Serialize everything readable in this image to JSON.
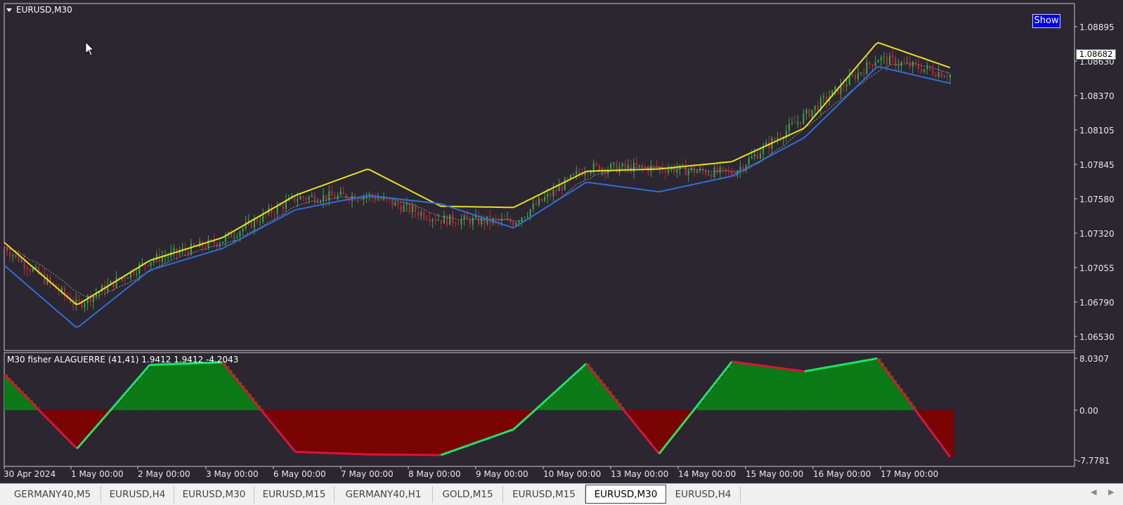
{
  "main_chart": {
    "symbol_label": "EURUSD,M30",
    "show_button": "Show",
    "current_price": "1.08682",
    "price_ticks": [
      "1.08895",
      "1.08630",
      "1.08370",
      "1.08105",
      "1.07845",
      "1.07580",
      "1.07320",
      "1.07055",
      "1.06790",
      "1.06530"
    ]
  },
  "indicator": {
    "label": "M30 fisher ALAGUERRE (41,41) 1.9412 1.9412 -4.2043",
    "ticks": [
      "8.0307",
      "0.00",
      "-7.7781"
    ]
  },
  "time_axis": {
    "labels": [
      "30 Apr 2024",
      "1 May 00:00",
      "2 May 00:00",
      "3 May 00:00",
      "6 May 00:00",
      "7 May 00:00",
      "8 May 00:00",
      "9 May 00:00",
      "10 May 00:00",
      "13 May 00:00",
      "14 May 00:00",
      "15 May 00:00",
      "16 May 00:00",
      "17 May 00:00"
    ]
  },
  "tabs": [
    {
      "label": "GERMANY40,M5",
      "active": false
    },
    {
      "label": "EURUSD,H4",
      "active": false
    },
    {
      "label": "EURUSD,M30",
      "active": false
    },
    {
      "label": "EURUSD,M15",
      "active": false
    },
    {
      "label": "GERMANY40,H1",
      "active": false
    },
    {
      "label": "GOLD,M15",
      "active": false
    },
    {
      "label": "EURUSD,M15",
      "active": false
    },
    {
      "label": "EURUSD,M30",
      "active": true
    },
    {
      "label": "EURUSD,H4",
      "active": false
    }
  ],
  "colors": {
    "background": "#2b2630",
    "bull_candle": "#3aa64a",
    "bear_candle": "#c0283c",
    "upper_band": "#e8e020",
    "lower_band": "#2f6fd6",
    "fisher_positive_fill": "#0b7a17",
    "fisher_negative_fill": "#7a0303",
    "fisher_up_line": "#19e86b",
    "fisher_down_line": "#e01238"
  },
  "chart_data": [
    {
      "type": "line",
      "title": "EURUSD,M30",
      "x": [
        "30 Apr 2024",
        "1 May 00:00",
        "2 May 00:00",
        "3 May 00:00",
        "6 May 00:00",
        "7 May 00:00",
        "8 May 00:00",
        "9 May 00:00",
        "10 May 00:00",
        "13 May 00:00",
        "14 May 00:00",
        "15 May 00:00",
        "16 May 00:00",
        "17 May 00:00"
      ],
      "ylim": [
        1.0645,
        1.0902
      ],
      "series": [
        {
          "values": [
            1.0719,
            1.0671,
            1.0708,
            1.0725,
            1.076,
            1.0762,
            1.0742,
            1.074,
            1.0785,
            1.0785,
            1.078,
            1.0828,
            1.0876,
            1.0862
          ]
        },
        {
          "values": [
            1.0723,
            1.0671,
            1.0708,
            1.0727,
            1.0762,
            1.0784,
            1.0753,
            1.0752,
            1.0782,
            1.0784,
            1.079,
            1.0818,
            1.0889,
            1.0868
          ]
        },
        {
          "values": [
            1.0704,
            1.0652,
            1.07,
            1.0718,
            1.075,
            1.0762,
            1.0755,
            1.0735,
            1.0773,
            1.0765,
            1.0778,
            1.081,
            1.0869,
            1.0855
          ]
        }
      ]
    },
    {
      "type": "area",
      "title": "M30 fisher ALAGUERRE (41,41) 1.9412 1.9412 -4.2043",
      "x": [
        "30 Apr 2024",
        "1 May 00:00",
        "2 May 00:00",
        "3 May 00:00",
        "6 May 00:00",
        "7 May 00:00",
        "8 May 00:00",
        "9 May 00:00",
        "10 May 00:00",
        "13 May 00:00",
        "14 May 00:00",
        "15 May 00:00",
        "16 May 00:00",
        "17 May 00:00"
      ],
      "ylim": [
        -7.7781,
        8.0307
      ],
      "series": [
        {
          "values": [
            5.5,
            -6.0,
            7.0,
            7.4,
            -6.5,
            -6.9,
            -7.0,
            -3.0,
            7.2,
            -6.8,
            7.5,
            6.0,
            8.0,
            -7.3
          ]
        }
      ]
    }
  ]
}
